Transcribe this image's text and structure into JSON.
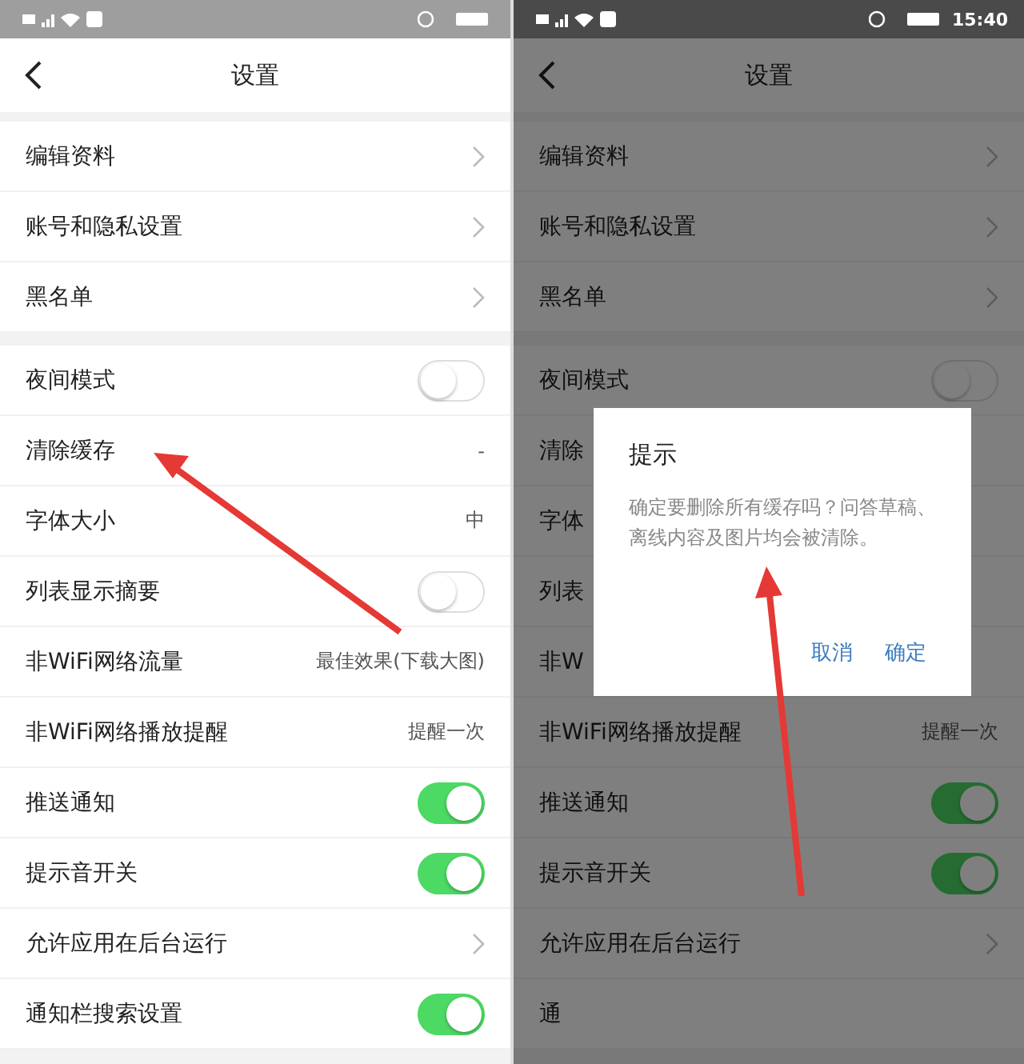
{
  "screens": [
    {
      "dimmed": false,
      "title": "设置",
      "groups": [
        [
          {
            "label": "编辑资料",
            "kind": "arrow"
          },
          {
            "label": "账号和隐私设置",
            "kind": "arrow"
          },
          {
            "label": "黑名单",
            "kind": "arrow"
          }
        ],
        [
          {
            "label": "夜间模式",
            "kind": "toggle",
            "on": false
          },
          {
            "label": "清除缓存",
            "kind": "value",
            "value": "-"
          },
          {
            "label": "字体大小",
            "kind": "value",
            "value": "中"
          },
          {
            "label": "列表显示摘要",
            "kind": "toggle",
            "on": false
          },
          {
            "label": "非WiFi网络流量",
            "kind": "value",
            "value": "最佳效果(下载大图)"
          },
          {
            "label": "非WiFi网络播放提醒",
            "kind": "value",
            "value": "提醒一次"
          },
          {
            "label": "推送通知",
            "kind": "toggle",
            "on": true
          },
          {
            "label": "提示音开关",
            "kind": "toggle",
            "on": true
          },
          {
            "label": "允许应用在后台运行",
            "kind": "arrow"
          },
          {
            "label": "通知栏搜索设置",
            "kind": "toggle",
            "on": true
          }
        ]
      ],
      "arrow": {
        "kind": "to-upper-left"
      }
    },
    {
      "dimmed": true,
      "status_time": "15:40",
      "title": "设置",
      "groups": [
        [
          {
            "label": "编辑资料",
            "kind": "arrow"
          },
          {
            "label": "账号和隐私设置",
            "kind": "arrow"
          },
          {
            "label": "黑名单",
            "kind": "arrow"
          }
        ],
        [
          {
            "label": "夜间模式",
            "kind": "toggle",
            "on": false
          },
          {
            "label": "清除",
            "kind": "plain"
          },
          {
            "label": "字体",
            "kind": "plain"
          },
          {
            "label": "列表",
            "kind": "plain"
          },
          {
            "label": "非W",
            "kind": "plain"
          },
          {
            "label": "非WiFi网络播放提醒",
            "kind": "value",
            "value": "提醒一次"
          },
          {
            "label": "推送通知",
            "kind": "toggle",
            "on": true
          },
          {
            "label": "提示音开关",
            "kind": "toggle",
            "on": true
          },
          {
            "label": "允许应用在后台运行",
            "kind": "arrow"
          },
          {
            "label": "通",
            "kind": "plain"
          }
        ]
      ],
      "dialog": {
        "title": "提示",
        "message": "确定要删除所有缓存吗？问答草稿、离线内容及图片均会被清除。",
        "buttons": [
          "取消",
          "确定"
        ]
      },
      "arrow": {
        "kind": "up"
      }
    }
  ]
}
